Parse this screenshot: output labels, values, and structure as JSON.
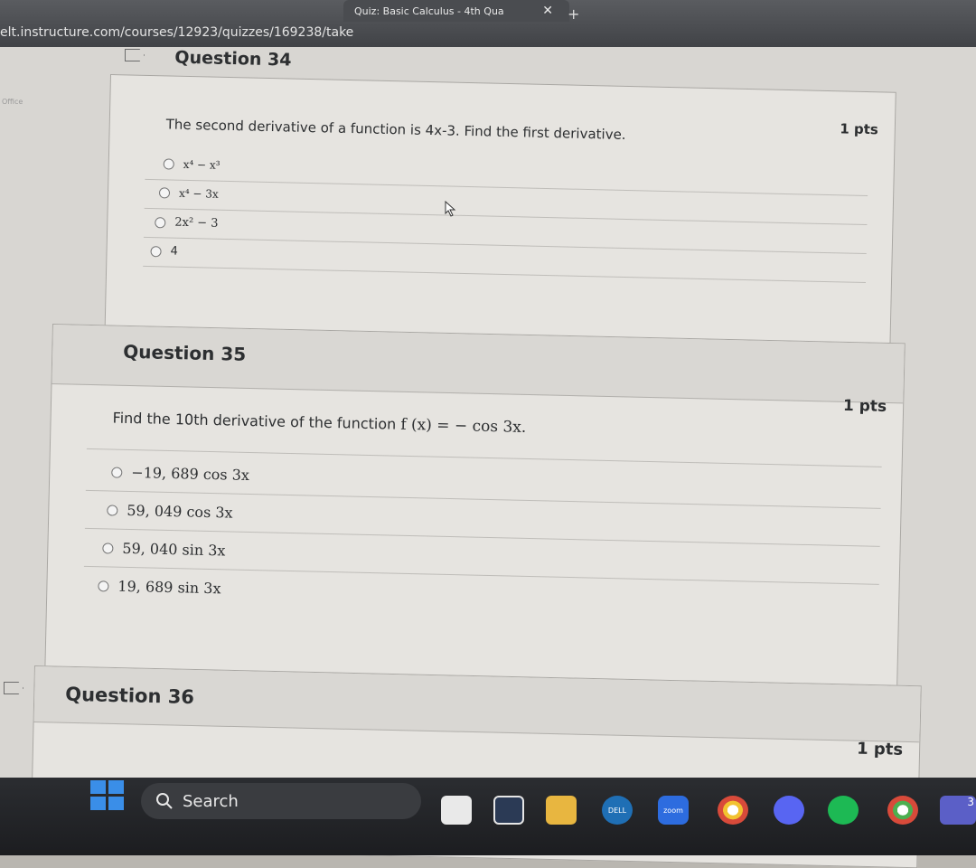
{
  "browser": {
    "tab_title": "Quiz: Basic Calculus - 4th Qua",
    "tab_close": "✕",
    "new_tab": "+",
    "url": "elt.instructure.com/courses/12923/quizzes/169238/take",
    "office_label": "Office"
  },
  "questions": [
    {
      "title": "Question 34",
      "points": "1 pts",
      "text": "The second derivative of a function is 4x-3. Find the first derivative.",
      "options": [
        "x⁴ − x³",
        "x⁴ − 3x",
        "2x² − 3",
        "4"
      ]
    },
    {
      "title": "Question 35",
      "points": "1 pts",
      "text_prefix": "Find the 10th derivative of the function ",
      "text_math": "f (x) = − cos 3x.",
      "options": [
        "−19, 689 cos 3x",
        "59, 049 cos 3x",
        "59, 040 sin 3x",
        "19, 689 sin 3x"
      ]
    },
    {
      "title": "Question 36",
      "points": "1 pts"
    }
  ],
  "taskbar": {
    "search_label": "Search",
    "apps": [
      "file-explorer-icon",
      "calculator-icon",
      "folder-icon",
      "dell-icon",
      "zoom-icon",
      "chrome-icon",
      "discord-icon",
      "spotify-icon",
      "chrome-alt-icon",
      "teams-icon"
    ],
    "dell_label": "DELL",
    "zoom_label": "zoom",
    "badge": "3"
  }
}
